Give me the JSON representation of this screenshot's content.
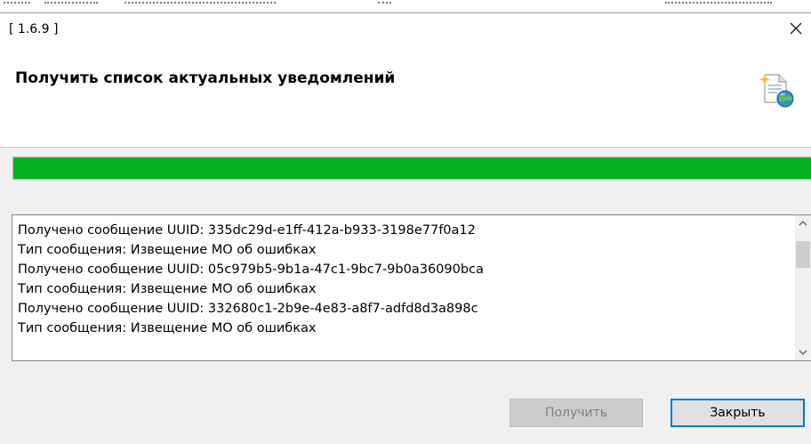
{
  "window": {
    "title": "[ 1.6.9 ]",
    "close_glyph": "×"
  },
  "header": {
    "heading": "Получить список актуальных уведомлений",
    "icon": "document-globe-icon"
  },
  "progress": {
    "percent": 100,
    "color": "#06b025"
  },
  "log": {
    "lines": [
      "Получено сообщение UUID: 335dc29d-e1ff-412a-b933-3198e77f0a12",
      "Тип сообщения: Извещение МО об ошибках",
      "Получено сообщение UUID: 05c979b5-9b1a-47c1-9bc7-9b0a36090bca",
      "Тип сообщения: Извещение МО об ошибках",
      "Получено сообщение UUID: 332680c1-2b9e-4e83-a8f7-adfd8d3a898c",
      "Тип сообщения: Извещение МО об ошибках"
    ]
  },
  "buttons": {
    "get_label": "Получить",
    "get_enabled": false,
    "close_label": "Закрыть"
  },
  "colors": {
    "accent": "#0078d7",
    "progress": "#06b025"
  }
}
